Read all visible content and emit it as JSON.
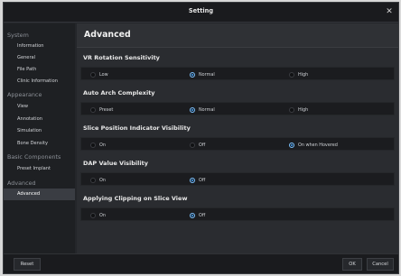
{
  "window": {
    "title": "Setting",
    "close_glyph": "✕"
  },
  "sidebar": {
    "system_label": "System",
    "system_items": [
      "Information",
      "General",
      "File Path",
      "Clinic Information"
    ],
    "appearance_label": "Appearance",
    "appearance_items": [
      "View",
      "Annotation",
      "Simulation",
      "Bone Density"
    ],
    "basic_label": "Basic Components",
    "basic_items": [
      "Preset Implant"
    ],
    "advanced_label": "Advanced",
    "advanced_items": [
      "Advanced"
    ]
  },
  "main": {
    "header": "Advanced",
    "sections": [
      {
        "title": "VR Rotation Sensitivity",
        "options": [
          "Low",
          "Normal",
          "High"
        ],
        "selected": "Normal"
      },
      {
        "title": "Auto Arch Complexity",
        "options": [
          "Preset",
          "Normal",
          "High"
        ],
        "selected": "Normal"
      },
      {
        "title": "Slice Position Indicator Visibility",
        "options": [
          "On",
          "Off",
          "On when Hovered"
        ],
        "selected": "On when Hovered"
      },
      {
        "title": "DAP Value Visibility",
        "options": [
          "On",
          "Off"
        ],
        "selected": "Off"
      },
      {
        "title": "Applying Clipping on Slice View",
        "options": [
          "On",
          "Off"
        ],
        "selected": "Off"
      }
    ]
  },
  "footer": {
    "reset_label": "Reset",
    "ok_label": "OK",
    "cancel_label": "Cancel"
  },
  "colors": {
    "accent": "#3ea0f6",
    "background": "#24262a"
  }
}
